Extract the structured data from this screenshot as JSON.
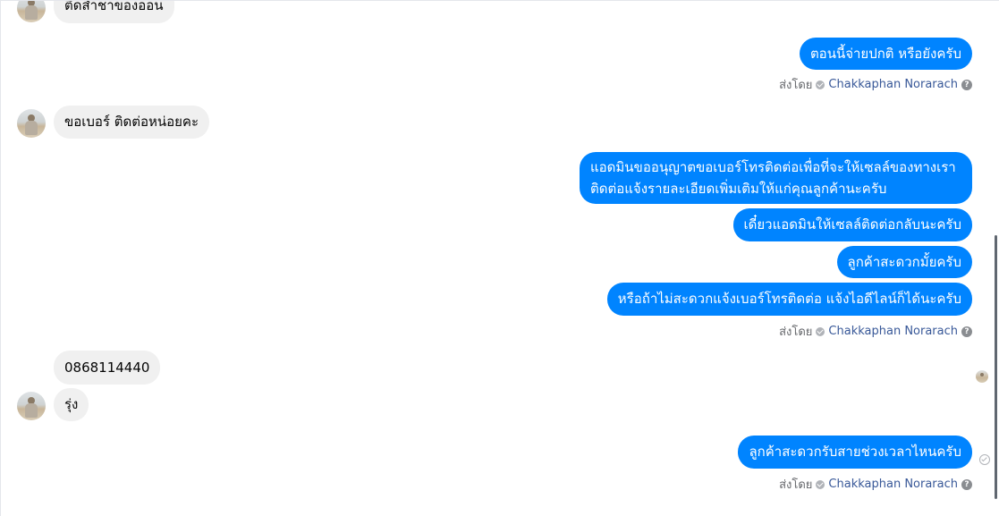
{
  "messages": {
    "m0": "ติดสำชาของออน",
    "m1": "ตอนนี้จ่ายปกติ หรือยังครับ",
    "m2": "ขอเบอร์ ติดต่อหน่อยคะ",
    "m3": "แอดมินขออนุญาตขอเบอร์โทรติดต่อเพื่อที่จะให้เซลล์ของทางเราติดต่อแจ้งรายละเอียดเพิ่มเติมให้แก่คุณลูกค้านะครับ",
    "m4": "เดี๋ยวแอดมินให้เซลล์ติดต่อกลับนะครับ",
    "m5": "ลูกค้าสะดวกมั้ยครับ",
    "m6": "หรือถ้าไม่สะดวกแจ้งเบอร์โทรติดต่อ แจ้งไอดีไลน์ก็ได้นะครับ",
    "m7": "0868114440",
    "m8": "รุ่ง",
    "m9": "ลูกค้าสะดวกรับสายช่วงเวลาไหนครับ"
  },
  "sent_by": {
    "label": "ส่งโดย",
    "name": "Chakkaphan Norarach",
    "help": "?"
  },
  "colors": {
    "outgoing_bubble": "#0084ff",
    "incoming_bubble": "#f0f0f0",
    "sender_link": "#385898"
  },
  "icons": {
    "verified": "verified-icon",
    "help": "help-icon",
    "delivered": "delivered-icon",
    "seen_avatar": "seen-avatar"
  }
}
